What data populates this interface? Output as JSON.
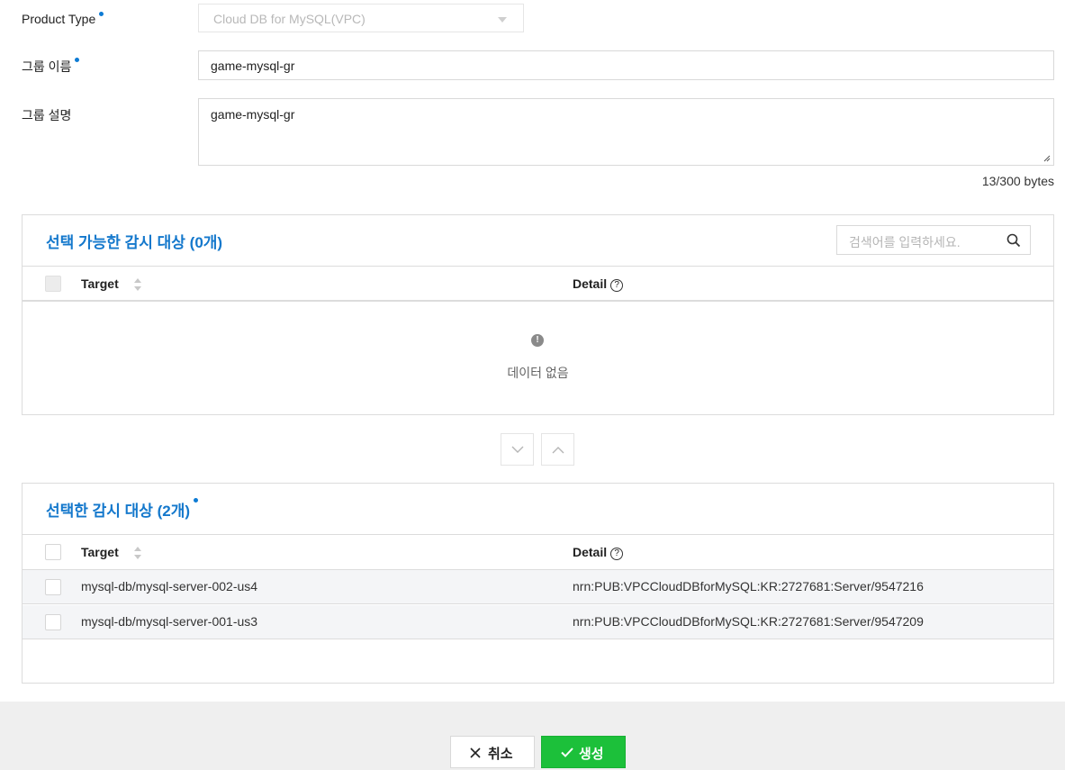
{
  "form": {
    "product_type": {
      "label": "Product Type",
      "value": "Cloud DB for MySQL(VPC)"
    },
    "group_name": {
      "label": "그룹 이름",
      "value": "game-mysql-gr"
    },
    "group_desc": {
      "label": "그룹 설명",
      "value": "game-mysql-gr"
    },
    "bytes_counter": "13/300 bytes"
  },
  "available": {
    "title": "선택 가능한 감시 대상 (0개)",
    "search_placeholder": "검색어를 입력하세요.",
    "columns": {
      "target": "Target",
      "detail": "Detail"
    },
    "empty_text": "데이터 없음"
  },
  "selected": {
    "title": "선택한 감시 대상 (2개)",
    "columns": {
      "target": "Target",
      "detail": "Detail"
    },
    "rows": [
      {
        "target": "mysql-db/mysql-server-002-us4",
        "detail": "nrn:PUB:VPCCloudDBforMySQL:KR:2727681:Server/9547216"
      },
      {
        "target": "mysql-db/mysql-server-001-us3",
        "detail": "nrn:PUB:VPCCloudDBforMySQL:KR:2727681:Server/9547209"
      }
    ]
  },
  "footer": {
    "cancel_label": "취소",
    "create_label": "생성"
  },
  "colors": {
    "accent": "#1478cc",
    "required_dot": "#0d7bd4",
    "create_button": "#1cc03a"
  }
}
